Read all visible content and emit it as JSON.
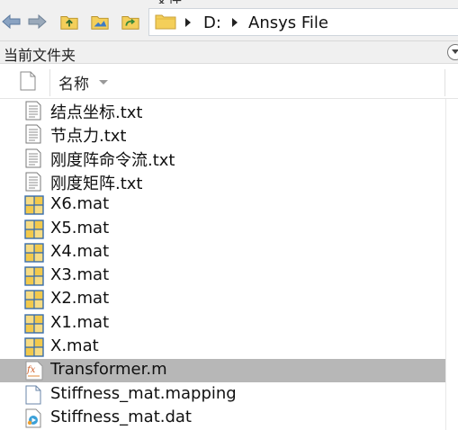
{
  "menu": {
    "cut_label": "文件"
  },
  "toolbar": {
    "back_icon": "back-arrow-icon",
    "forward_icon": "forward-arrow-icon",
    "up_icon": "up-folder-icon",
    "open_icon": "open-folder-icon",
    "refresh_icon": "refresh-folder-icon"
  },
  "address": {
    "segments": [
      "D:",
      "Ansys File"
    ]
  },
  "pane": {
    "title": "当前文件夹"
  },
  "columns": {
    "name": "名称"
  },
  "files": [
    {
      "name": "结点坐标.txt",
      "type": "txt"
    },
    {
      "name": "节点力.txt",
      "type": "txt"
    },
    {
      "name": "刚度阵命令流.txt",
      "type": "txt"
    },
    {
      "name": "刚度矩阵.txt",
      "type": "txt"
    },
    {
      "name": "X6.mat",
      "type": "mat"
    },
    {
      "name": "X5.mat",
      "type": "mat"
    },
    {
      "name": "X4.mat",
      "type": "mat"
    },
    {
      "name": "X3.mat",
      "type": "mat"
    },
    {
      "name": "X2.mat",
      "type": "mat"
    },
    {
      "name": "X1.mat",
      "type": "mat"
    },
    {
      "name": "X.mat",
      "type": "mat"
    },
    {
      "name": "Transformer.m",
      "type": "m",
      "selected": true
    },
    {
      "name": "Stiffness_mat.mapping",
      "type": "generic"
    },
    {
      "name": "Stiffness_mat.dat",
      "type": "dat"
    }
  ],
  "colors": {
    "toolbar_bg": "#f0f0f0",
    "selection_bg": "#b7b7b7",
    "mat_icon_yellow": "#f2c94c",
    "mat_icon_border": "#3a6fb0"
  }
}
